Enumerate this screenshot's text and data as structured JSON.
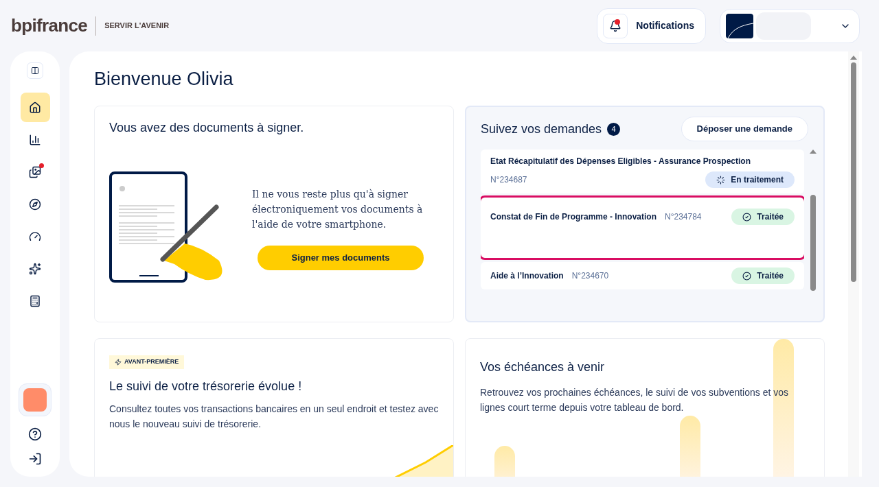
{
  "header": {
    "logo": "bpifrance",
    "tagline": "SERVIR L'AVENIR",
    "notifications": {
      "label": "Notifications",
      "unread": true
    }
  },
  "sidebar": {
    "items": [
      {
        "selected": true,
        "badge": false
      },
      {
        "selected": false,
        "badge": false
      },
      {
        "selected": false,
        "badge": true
      },
      {
        "selected": false,
        "badge": false
      },
      {
        "selected": false,
        "badge": false
      },
      {
        "selected": false,
        "badge": false
      },
      {
        "selected": false,
        "badge": false
      }
    ]
  },
  "greeting": "Bienvenue Olivia",
  "sign_card": {
    "title": "Vous avez des documents à signer.",
    "text": "Il ne vous reste plus qu'à signer électroniquement vos documents à l'aide de votre smartphone.",
    "button": "Signer mes documents"
  },
  "requests": {
    "title": "Suivez vos demandes",
    "count": "4",
    "button": "Déposer une demande",
    "items": [
      {
        "title": "Etat Récapitulatif des Dépenses Eligibles - Assurance Prospection",
        "number": "N°234687",
        "status": {
          "kind": "processing",
          "label": "En traitement"
        },
        "highlighted": false
      },
      {
        "title": "Constat de Fin de Programme - Innovation",
        "number": "N°234784",
        "status": {
          "kind": "done",
          "label": "Traitée"
        },
        "highlighted": true
      },
      {
        "title": "Aide à l’Innovation",
        "number": "N°234670",
        "status": {
          "kind": "done",
          "label": "Traitée"
        },
        "highlighted": false
      }
    ]
  },
  "treasury_card": {
    "tag": "AVANT-PREMIÈRE",
    "title": "Le suivi de votre trésorerie évolue !",
    "text": "Consultez toutes vos transactions bancaires en un seul endroit et testez avec nous le nouveau suivi de trésorerie."
  },
  "deadlines_card": {
    "title": "Vos échéances à venir",
    "text": "Retrouvez vos prochaines échéances, le suivi de vos subventions et vos lignes court terme depuis votre tableau de bord."
  }
}
